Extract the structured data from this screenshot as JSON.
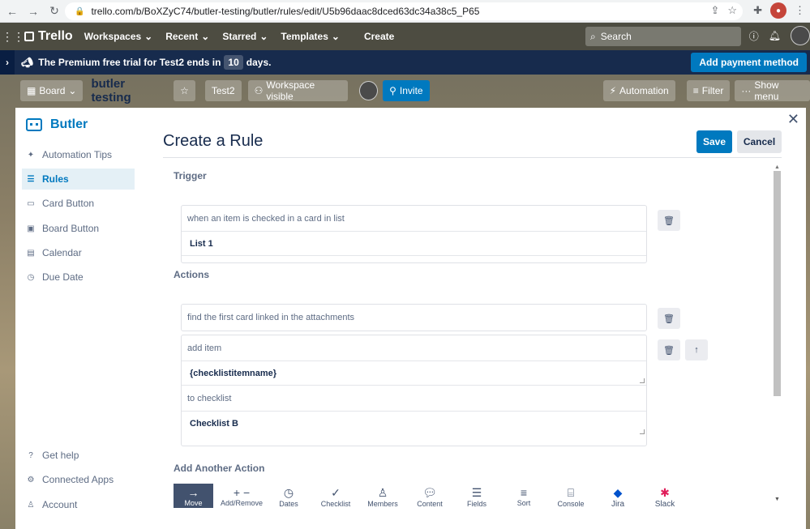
{
  "browser": {
    "url": "trello.com/b/BoXZyC74/butler-testing/butler/rules/edit/U5b96daac8dced63dc34a38c5_P65"
  },
  "header": {
    "logo": "Trello",
    "nav": [
      "Workspaces",
      "Recent",
      "Starred",
      "Templates"
    ],
    "create": "Create",
    "search_placeholder": "Search"
  },
  "banner": {
    "text_before": "The Premium free trial for Test2 ends in",
    "days": "10",
    "text_after": "days.",
    "button": "Add payment method"
  },
  "boardbar": {
    "view": "Board",
    "title": "butler testing",
    "workspace": "Test2",
    "visibility": "Workspace visible",
    "invite": "Invite",
    "automation": "Automation",
    "filter": "Filter",
    "show_menu": "Show menu"
  },
  "sidebar": {
    "title": "Butler",
    "items": [
      {
        "label": "Automation Tips",
        "icon": "sparkle-icon"
      },
      {
        "label": "Rules",
        "icon": "sliders-icon"
      },
      {
        "label": "Card Button",
        "icon": "card-icon"
      },
      {
        "label": "Board Button",
        "icon": "board-icon"
      },
      {
        "label": "Calendar",
        "icon": "calendar-icon"
      },
      {
        "label": "Due Date",
        "icon": "clock-icon"
      }
    ],
    "footer": [
      {
        "label": "Get help",
        "icon": "help-icon"
      },
      {
        "label": "Connected Apps",
        "icon": "gear-icon"
      },
      {
        "label": "Account",
        "icon": "user-icon"
      }
    ]
  },
  "main": {
    "title": "Create a Rule",
    "save": "Save",
    "cancel": "Cancel",
    "trigger_label": "Trigger",
    "trigger_text": "when an item is checked in a card in list",
    "trigger_value": "List 1",
    "actions_label": "Actions",
    "action1_text": "find the first card linked in the attachments",
    "action2_text": "add item",
    "action2_value": "{checklistitemname}",
    "action2_text2": "to checklist",
    "action2_value2": "Checklist B",
    "add_another": "Add Another Action",
    "action_types": [
      "Move",
      "Add/Remove",
      "Dates",
      "Checklist",
      "Members",
      "Content",
      "Fields",
      "Sort",
      "Console",
      "Jira",
      "Slack"
    ]
  }
}
